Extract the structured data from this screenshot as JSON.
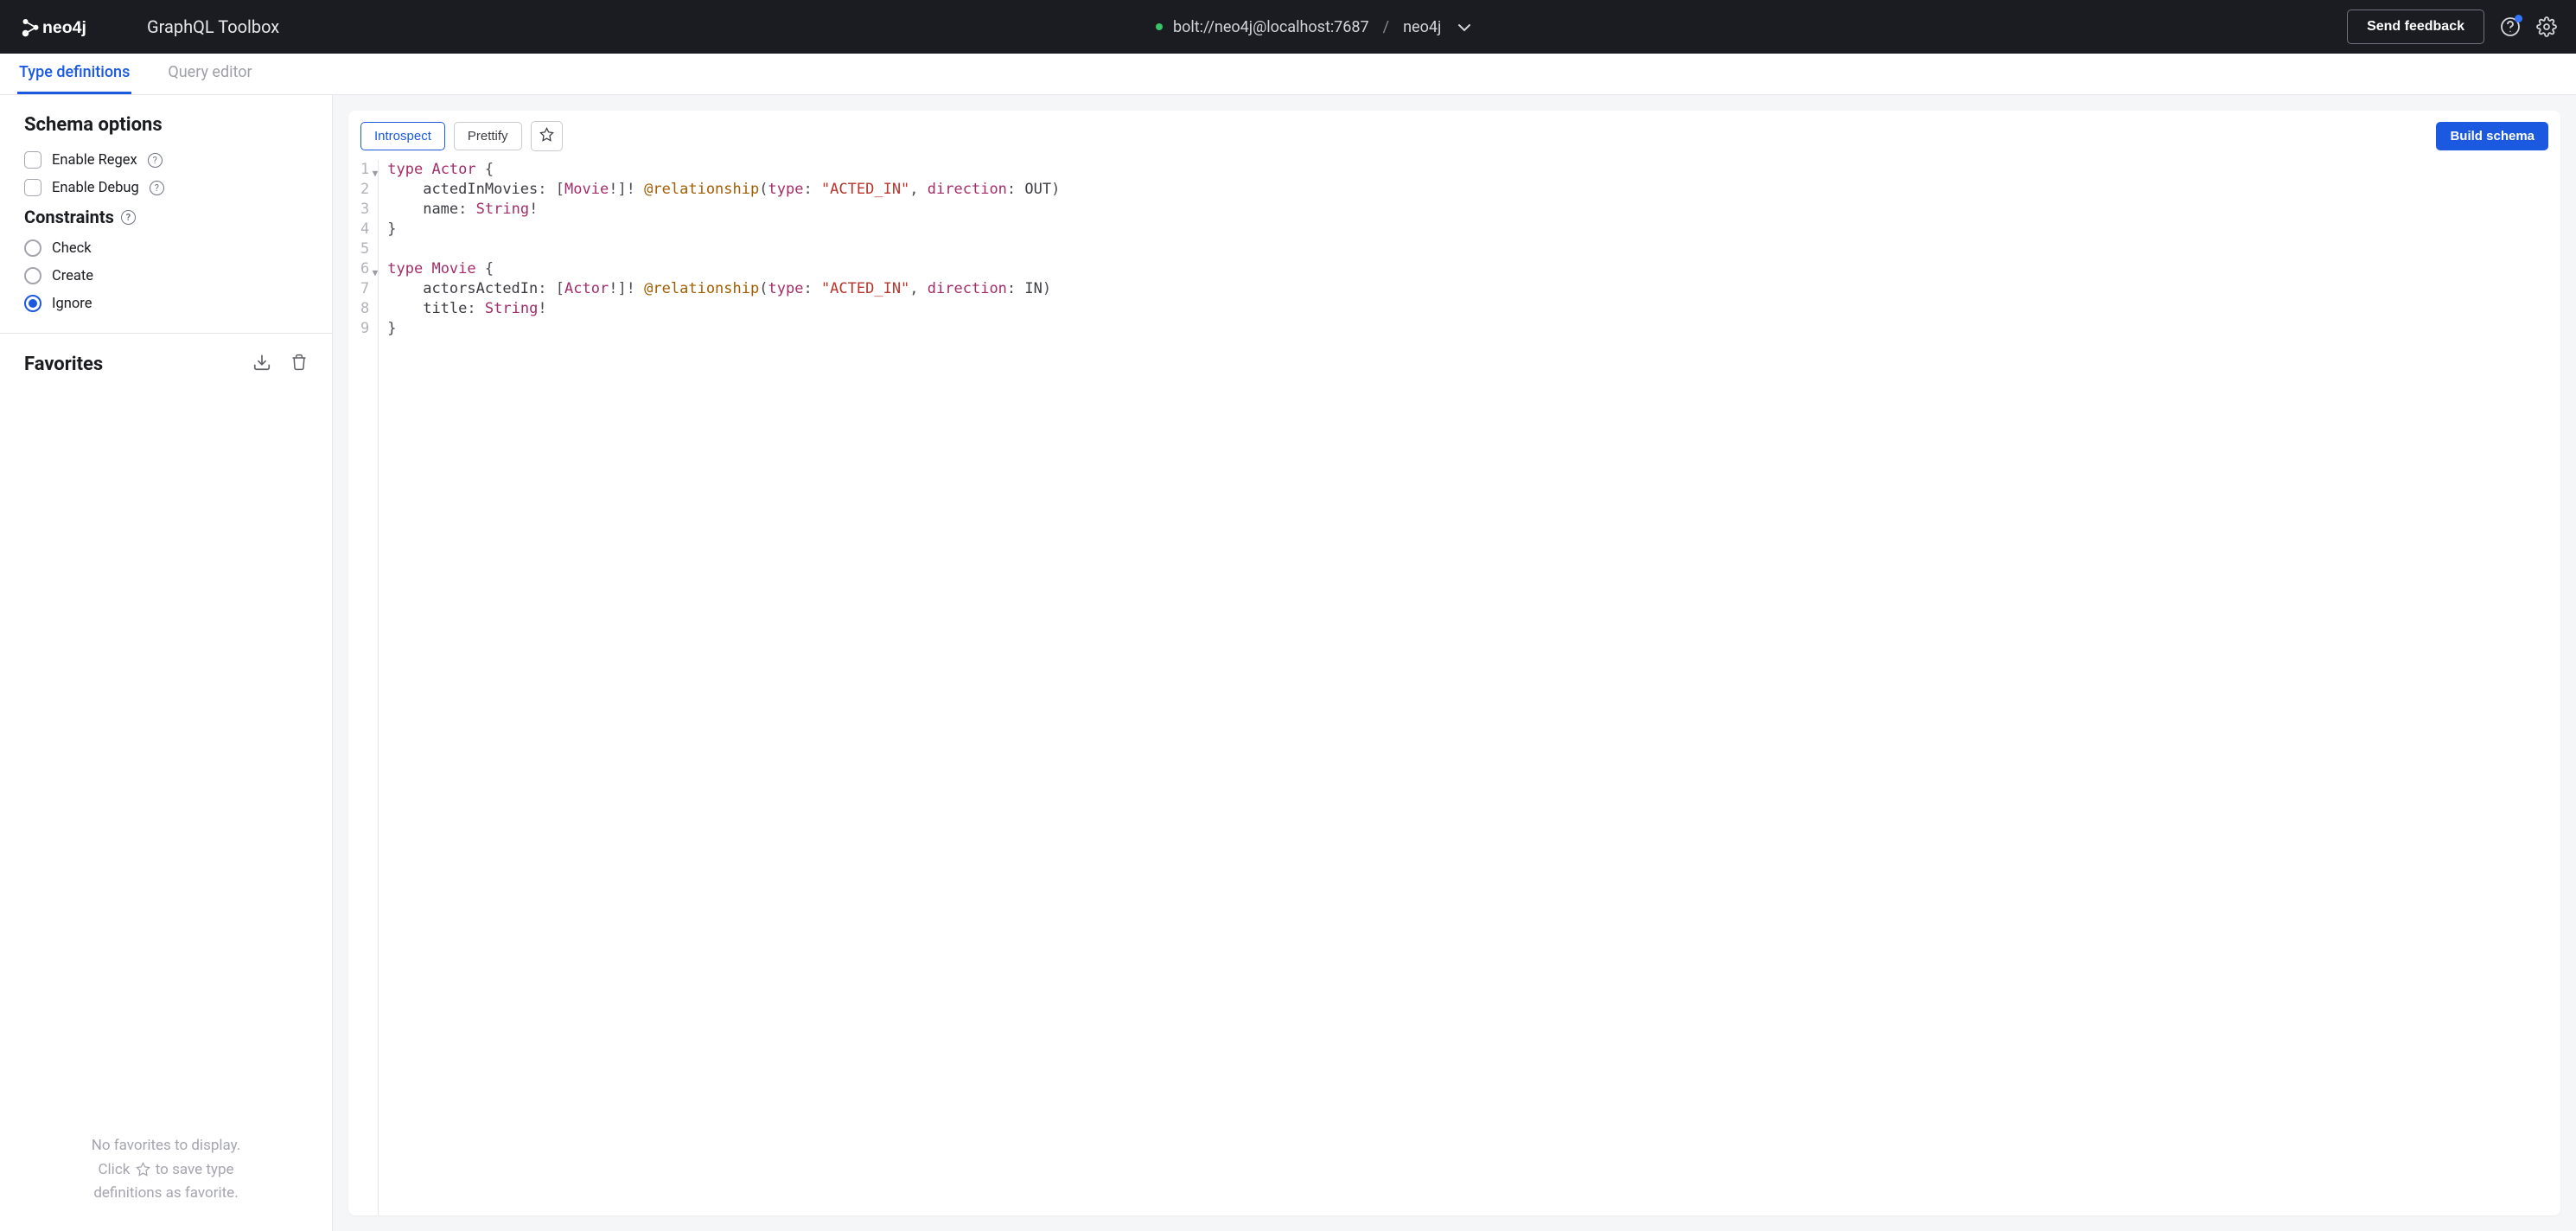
{
  "header": {
    "logo_text": "neo4j",
    "product": "GraphQL Toolbox",
    "connection": "bolt://neo4j@localhost:7687",
    "database": "neo4j",
    "feedback_label": "Send feedback"
  },
  "tabs": {
    "type_definitions": "Type definitions",
    "query_editor": "Query editor"
  },
  "sidebar": {
    "schema_options_title": "Schema options",
    "enable_regex": "Enable Regex",
    "enable_debug": "Enable Debug",
    "constraints_title": "Constraints",
    "constraints": {
      "check": "Check",
      "create": "Create",
      "ignore": "Ignore",
      "selected": "ignore"
    },
    "favorites_title": "Favorites",
    "favorites_empty_1": "No favorites to display.",
    "favorites_empty_2a": "Click ",
    "favorites_empty_2b": " to save type",
    "favorites_empty_3": "definitions as favorite."
  },
  "toolbar": {
    "introspect": "Introspect",
    "prettify": "Prettify",
    "build_schema": "Build schema"
  },
  "editor": {
    "lines": [
      {
        "n": 1,
        "fold": true,
        "tokens": [
          [
            "kw",
            "type"
          ],
          [
            "sp",
            " "
          ],
          [
            "type",
            "Actor"
          ],
          [
            "sp",
            " "
          ],
          [
            "punc",
            "{"
          ]
        ]
      },
      {
        "n": 2,
        "tokens": [
          [
            "sp",
            "    "
          ],
          [
            "field",
            "actedInMovies"
          ],
          [
            "punc",
            ":"
          ],
          [
            "sp",
            " "
          ],
          [
            "punc",
            "["
          ],
          [
            "type",
            "Movie"
          ],
          [
            "punc",
            "!]!"
          ],
          [
            "sp",
            " "
          ],
          [
            "dir",
            "@relationship"
          ],
          [
            "punc",
            "("
          ],
          [
            "arg",
            "type"
          ],
          [
            "punc",
            ":"
          ],
          [
            "sp",
            " "
          ],
          [
            "str",
            "\"ACTED_IN\""
          ],
          [
            "punc",
            ","
          ],
          [
            "sp",
            " "
          ],
          [
            "arg",
            "direction"
          ],
          [
            "punc",
            ":"
          ],
          [
            "sp",
            " "
          ],
          [
            "enum",
            "OUT"
          ],
          [
            "punc",
            ")"
          ]
        ]
      },
      {
        "n": 3,
        "tokens": [
          [
            "sp",
            "    "
          ],
          [
            "field",
            "name"
          ],
          [
            "punc",
            ":"
          ],
          [
            "sp",
            " "
          ],
          [
            "type",
            "String"
          ],
          [
            "punc",
            "!"
          ]
        ]
      },
      {
        "n": 4,
        "tokens": [
          [
            "punc",
            "}"
          ]
        ]
      },
      {
        "n": 5,
        "tokens": []
      },
      {
        "n": 6,
        "fold": true,
        "tokens": [
          [
            "kw",
            "type"
          ],
          [
            "sp",
            " "
          ],
          [
            "type",
            "Movie"
          ],
          [
            "sp",
            " "
          ],
          [
            "punc",
            "{"
          ]
        ]
      },
      {
        "n": 7,
        "tokens": [
          [
            "sp",
            "    "
          ],
          [
            "field",
            "actorsActedIn"
          ],
          [
            "punc",
            ":"
          ],
          [
            "sp",
            " "
          ],
          [
            "punc",
            "["
          ],
          [
            "type",
            "Actor"
          ],
          [
            "punc",
            "!]!"
          ],
          [
            "sp",
            " "
          ],
          [
            "dir",
            "@relationship"
          ],
          [
            "punc",
            "("
          ],
          [
            "arg",
            "type"
          ],
          [
            "punc",
            ":"
          ],
          [
            "sp",
            " "
          ],
          [
            "str",
            "\"ACTED_IN\""
          ],
          [
            "punc",
            ","
          ],
          [
            "sp",
            " "
          ],
          [
            "arg",
            "direction"
          ],
          [
            "punc",
            ":"
          ],
          [
            "sp",
            " "
          ],
          [
            "enum",
            "IN"
          ],
          [
            "punc",
            ")"
          ]
        ]
      },
      {
        "n": 8,
        "tokens": [
          [
            "sp",
            "    "
          ],
          [
            "field",
            "title"
          ],
          [
            "punc",
            ":"
          ],
          [
            "sp",
            " "
          ],
          [
            "type",
            "String"
          ],
          [
            "punc",
            "!"
          ]
        ]
      },
      {
        "n": 9,
        "tokens": [
          [
            "punc",
            "}"
          ]
        ]
      }
    ]
  }
}
